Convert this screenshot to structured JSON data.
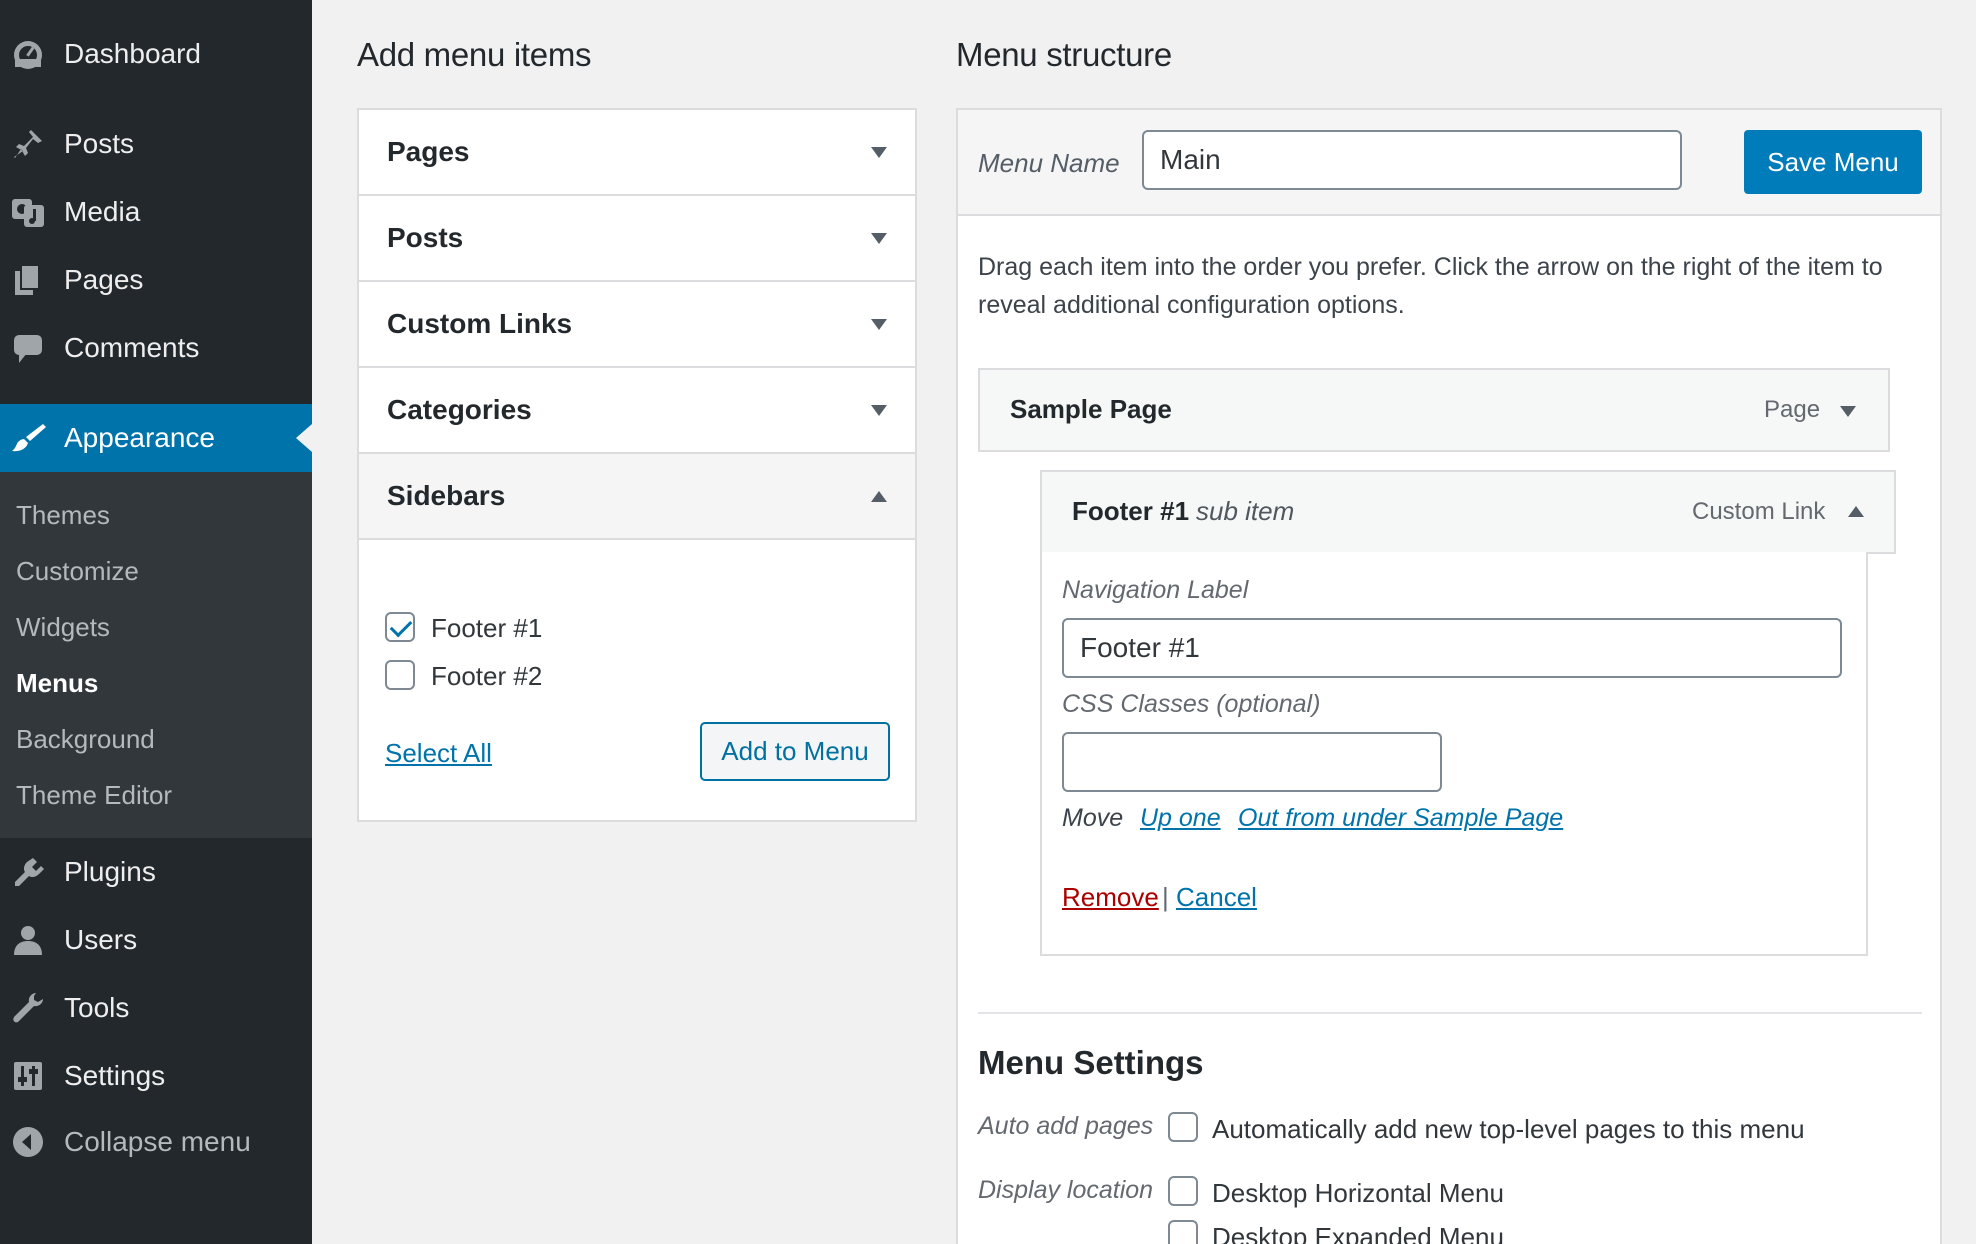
{
  "sidebar": {
    "items": [
      {
        "label": "Dashboard",
        "icon": "dashboard-icon"
      },
      {
        "label": "Posts",
        "icon": "pin-icon"
      },
      {
        "label": "Media",
        "icon": "media-icon"
      },
      {
        "label": "Pages",
        "icon": "pages-icon"
      },
      {
        "label": "Comments",
        "icon": "comment-icon"
      },
      {
        "label": "Appearance",
        "icon": "brush-icon"
      },
      {
        "label": "Plugins",
        "icon": "plug-icon"
      },
      {
        "label": "Users",
        "icon": "user-icon"
      },
      {
        "label": "Tools",
        "icon": "wrench-icon"
      },
      {
        "label": "Settings",
        "icon": "sliders-icon"
      }
    ],
    "submenu": [
      "Themes",
      "Customize",
      "Widgets",
      "Menus",
      "Background",
      "Theme Editor"
    ],
    "collapse": "Collapse menu",
    "active_color": "#0073aa"
  },
  "left": {
    "title": "Add menu items",
    "sections": [
      "Pages",
      "Posts",
      "Custom Links",
      "Categories",
      "Sidebars"
    ],
    "sidebars": [
      {
        "label": "Footer #1",
        "checked": true
      },
      {
        "label": "Footer #2",
        "checked": false
      }
    ],
    "select_all": "Select All",
    "add_button": "Add to Menu"
  },
  "right": {
    "title": "Menu structure",
    "menu_name_label": "Menu Name",
    "menu_name_value": "Main",
    "save_button": "Save Menu",
    "instructions": "Drag each item into the order you prefer. Click the arrow on the right of the item to reveal additional configuration options.",
    "item1": {
      "title": "Sample Page",
      "type": "Page"
    },
    "item2": {
      "title": "Footer #1",
      "sub": "sub item",
      "type": "Custom Link"
    },
    "nav_label_label": "Navigation Label",
    "nav_label_value": "Footer #1",
    "css_label": "CSS Classes (optional)",
    "css_value": "",
    "move_label": "Move",
    "move_up": "Up one",
    "move_out": "Out from under Sample Page",
    "remove": "Remove",
    "separator": "|",
    "cancel": "Cancel",
    "settings_title": "Menu Settings",
    "auto_add_label": "Auto add pages",
    "auto_add_text": "Automatically add new top-level pages to this menu",
    "display_label": "Display location",
    "locations": [
      "Desktop Horizontal Menu",
      "Desktop Expanded Menu"
    ]
  }
}
